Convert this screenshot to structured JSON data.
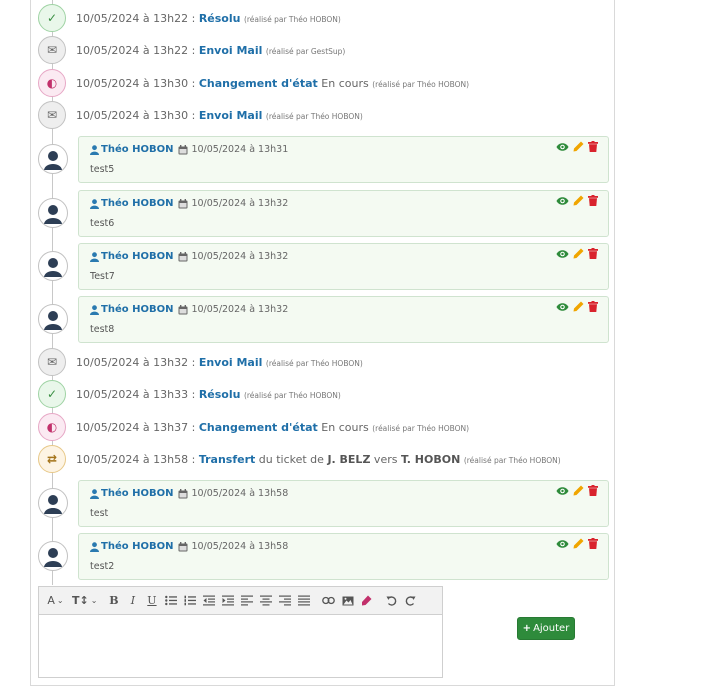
{
  "events": [
    {
      "icon": "check-icon",
      "date": "10/05/2024 à 13h22",
      "sep": " : ",
      "action": "Résolu",
      "rest": " ",
      "by": "(réalisé par Théo HOBON)"
    },
    {
      "icon": "mail-icon",
      "date": "10/05/2024 à 13h22",
      "sep": " : ",
      "action": "Envoi Mail",
      "rest": " ",
      "by": "(réalisé par GestSup)"
    },
    {
      "icon": "half-circle-icon",
      "date": "10/05/2024 à 13h30",
      "sep": " : ",
      "action": "Changement d'état",
      "rest": " En cours ",
      "by": "(réalisé par Théo HOBON)"
    },
    {
      "icon": "mail-icon",
      "date": "10/05/2024 à 13h30",
      "sep": " : ",
      "action": "Envoi Mail",
      "rest": " ",
      "by": "(réalisé par Théo HOBON)"
    },
    {
      "icon": "mail-icon",
      "date": "10/05/2024 à 13h32",
      "sep": " : ",
      "action": "Envoi Mail",
      "rest": " ",
      "by": "(réalisé par Théo HOBON)"
    },
    {
      "icon": "check-icon",
      "date": "10/05/2024 à 13h33",
      "sep": " : ",
      "action": "Résolu",
      "rest": " ",
      "by": "(réalisé par Théo HOBON)"
    },
    {
      "icon": "half-circle-icon",
      "date": "10/05/2024 à 13h37",
      "sep": " : ",
      "action": "Changement d'état",
      "rest": " En cours ",
      "by": "(réalisé par Théo HOBON)"
    }
  ],
  "transfer": {
    "date": "10/05/2024 à 13h58",
    "sep": " : ",
    "action": "Transfert",
    "mid1": " du ticket de ",
    "from": "J. BELZ",
    "mid2": " vers ",
    "to": "T. HOBON",
    "by": "(réalisé par Théo HOBON)"
  },
  "comments": [
    {
      "author": "Théo HOBON",
      "date": "10/05/2024 à 13h31",
      "text": "test5"
    },
    {
      "author": "Théo HOBON",
      "date": "10/05/2024 à 13h32",
      "text": "test6"
    },
    {
      "author": "Théo HOBON",
      "date": "10/05/2024 à 13h32",
      "text": "Test7"
    },
    {
      "author": "Théo HOBON",
      "date": "10/05/2024 à 13h32",
      "text": "test8"
    },
    {
      "author": "Théo HOBON",
      "date": "10/05/2024 à 13h58",
      "text": "test"
    },
    {
      "author": "Théo HOBON",
      "date": "10/05/2024 à 13h58",
      "text": "test2"
    }
  ],
  "editor": {
    "font_button": "A",
    "size_button": "T↕",
    "bold": "B",
    "italic": "I",
    "underline": "U"
  },
  "add_button_label": "Ajouter",
  "add_button_icon": "+",
  "colors": {
    "accent": "#1f6fa8",
    "success": "#2e8b3b",
    "edit": "#f0a500",
    "delete": "#d9232d"
  }
}
